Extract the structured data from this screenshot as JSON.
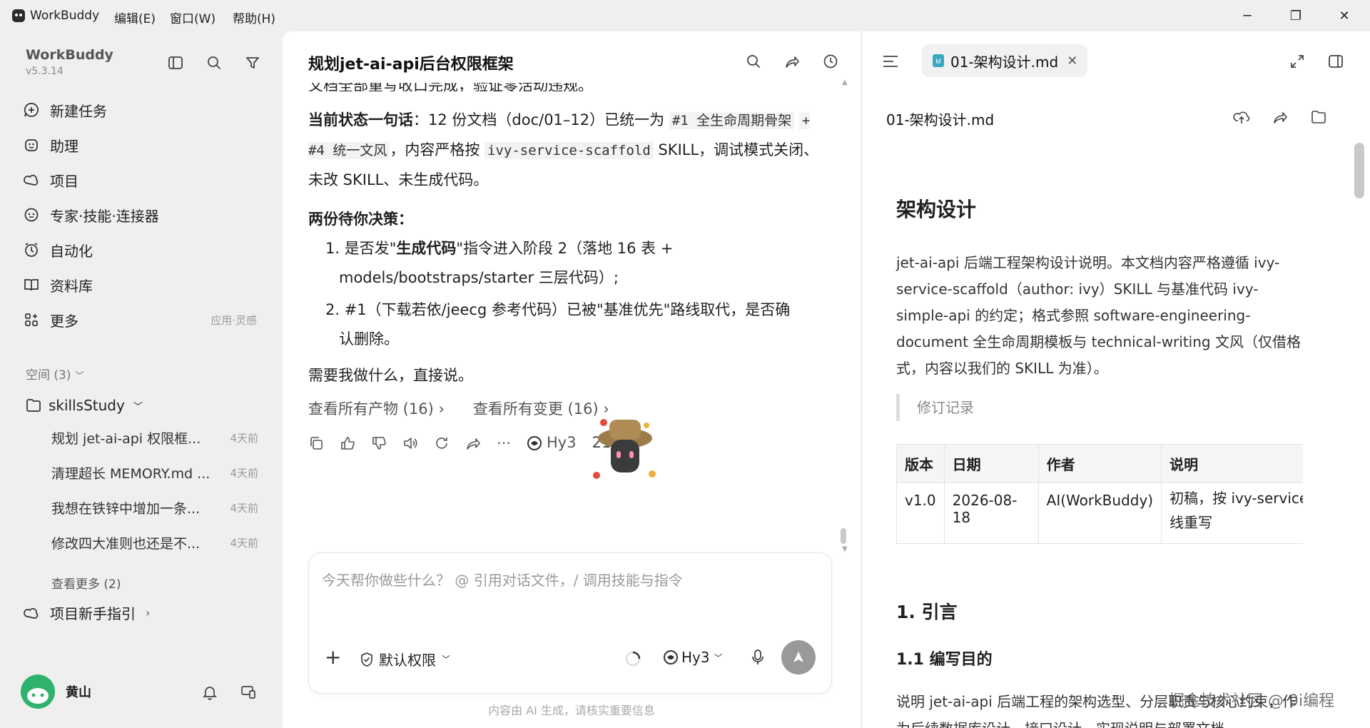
{
  "titlebar": {
    "app_name": "WorkBuddy",
    "menus": [
      "编辑(E)",
      "窗口(W)",
      "帮助(H)"
    ]
  },
  "sidebar": {
    "brand": "WorkBuddy",
    "version": "v5.3.14",
    "nav": [
      {
        "label": "新建任务",
        "icon": "new-task-icon"
      },
      {
        "label": "助理",
        "icon": "assistant-icon"
      },
      {
        "label": "项目",
        "icon": "project-icon"
      },
      {
        "label": "专家·技能·连接器",
        "icon": "expert-icon"
      },
      {
        "label": "自动化",
        "icon": "automation-icon"
      },
      {
        "label": "资料库",
        "icon": "library-icon"
      },
      {
        "label": "更多",
        "icon": "more-icon",
        "extra": "应用·灵感"
      }
    ],
    "space_header": "空间 (3)",
    "folder": "skillsStudy",
    "tasks": [
      {
        "title": "规划 jet-ai-api 权限框...",
        "time": "4天前"
      },
      {
        "title": "清理超长 MEMORY.md ...",
        "time": "4天前"
      },
      {
        "title": "我想在铁锌中增加一条...",
        "time": "4天前"
      },
      {
        "title": "修改四大准则也还是不...",
        "time": "4天前"
      }
    ],
    "view_more": "查看更多 (2)",
    "guide": "项目新手指引",
    "user": "黄山"
  },
  "chat": {
    "title": "规划jet-ai-api后台权限框架",
    "cut_top": "文档全部重写收口完成，验证零活动违规。",
    "status_label": "当前状态一句话",
    "status_1": "：12 份文档（doc/01–12）已统一为 ",
    "code_1": "#1 全生命周期骨架",
    "code_2": "+ #4 统一文风",
    "status_2": "，内容严格按 ",
    "code_3": "ivy-service-scaffold",
    "status_3": " SKILL，调试模式关闭、未改 SKILL、未生成代码。",
    "decision_title": "两份待你决策：",
    "item1_a": "1. 是否发\"",
    "item1_bold": "生成代码",
    "item1_b": "\"指令进入阶段 2（落地 16 表 +",
    "item1_c": "models/bootstraps/starter 三层代码）;",
    "item2_a": "2. #1（下载若依/jeecg 参考代码）已被\"基准优先\"路线取代，是否确",
    "item2_b": "认删除。",
    "closing": "需要我做什么，直接说。",
    "link_artifacts": "查看所有产物 (16)",
    "link_changes": "查看所有变更 (16)",
    "model": "Hy3",
    "time": "21:51",
    "input_placeholder": "今天帮你做些什么？ @ 引用对话文件，/ 调用技能与指令",
    "permission": "默认权限",
    "model_select": "Hy3",
    "disclaimer": "内容由 AI 生成，请核实重要信息"
  },
  "doc": {
    "tab_label": "01-架构设计.md",
    "file_name": "01-架构设计.md",
    "h1": "架构设计",
    "intro": "jet-ai-api 后端工程架构设计说明。本文档内容严格遵循 ivy-service-scaffold（author: ivy）SKILL 与基准代码 ivy-simple-api 的约定；格式参照 software-engineering-document 全生命周期模板与 technical-writing 文风（仅借格式，内容以我们的 SKILL 为准）。",
    "revision_label": "修订记录",
    "table": {
      "headers": [
        "版本",
        "日期",
        "作者",
        "说明"
      ],
      "row": [
        "v1.0",
        "2026-08-18",
        "AI(WorkBuddy)",
        "初稿，按 ivy-service-式基线重写"
      ]
    },
    "h2_1": "1. 引言",
    "h3_1": "1.1 编写目的",
    "para_bottom": "说明 jet-ai-api 后端工程的架构选型、分层职责与核心约束，作为后续数据库设计、接口设计、实现说明与部署文档",
    "watermark": "掘金技术社区 @ 9i编程"
  }
}
